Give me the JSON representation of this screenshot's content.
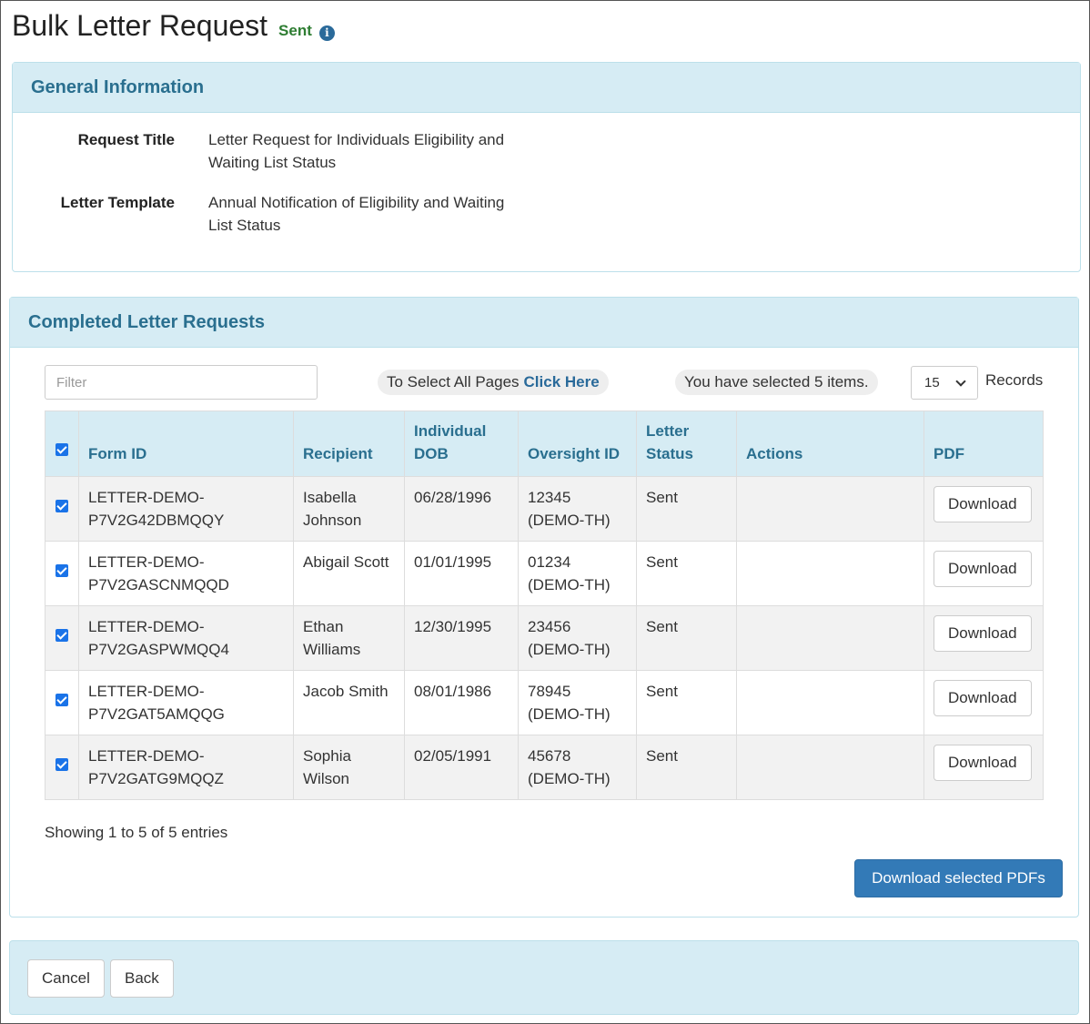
{
  "header": {
    "title": "Bulk Letter Request",
    "status": "Sent",
    "info_icon": "info-icon"
  },
  "general": {
    "heading": "General Information",
    "fields": [
      {
        "label": "Request Title",
        "value": "Letter Request for Individuals Eligibility and Waiting List Status"
      },
      {
        "label": "Letter Template",
        "value": "Annual Notification of Eligibility and Waiting List Status"
      }
    ]
  },
  "completed": {
    "heading": "Completed Letter Requests",
    "filter_placeholder": "Filter",
    "select_all_text": "To Select All Pages",
    "select_all_link": "Click Here",
    "selected_text": "You have selected 5 items.",
    "records_value": "15",
    "records_label": "Records",
    "columns": [
      "Form ID",
      "Recipient",
      "Individual DOB",
      "Oversight ID",
      "Letter Status",
      "Actions",
      "PDF"
    ],
    "rows": [
      {
        "form_id": "LETTER-DEMO-P7V2G42DBMQQY",
        "recipient": "Isabella Johnson",
        "dob": "06/28/1996",
        "oversight_id": "12345 (DEMO-TH)",
        "status": "Sent",
        "actions": "",
        "pdf": "Download"
      },
      {
        "form_id": "LETTER-DEMO-P7V2GASCNMQQD",
        "recipient": "Abigail Scott",
        "dob": "01/01/1995",
        "oversight_id": "01234 (DEMO-TH)",
        "status": "Sent",
        "actions": "",
        "pdf": "Download"
      },
      {
        "form_id": "LETTER-DEMO-P7V2GASPWMQQ4",
        "recipient": "Ethan Williams",
        "dob": "12/30/1995",
        "oversight_id": "23456 (DEMO-TH)",
        "status": "Sent",
        "actions": "",
        "pdf": "Download"
      },
      {
        "form_id": "LETTER-DEMO-P7V2GAT5AMQQG",
        "recipient": "Jacob Smith",
        "dob": "08/01/1986",
        "oversight_id": "78945 (DEMO-TH)",
        "status": "Sent",
        "actions": "",
        "pdf": "Download"
      },
      {
        "form_id": "LETTER-DEMO-P7V2GATG9MQQZ",
        "recipient": "Sophia Wilson",
        "dob": "02/05/1991",
        "oversight_id": "45678 (DEMO-TH)",
        "status": "Sent",
        "actions": "",
        "pdf": "Download"
      }
    ],
    "showing": "Showing 1 to 5 of 5 entries",
    "download_selected": "Download selected PDFs"
  },
  "footer": {
    "cancel": "Cancel",
    "back": "Back"
  },
  "colors": {
    "accent": "#337ab7",
    "heading_bg": "#d6ecf4",
    "heading_text": "#2a6f8f",
    "status_sent": "#2e7d32",
    "checkbox": "#1a73e8"
  }
}
